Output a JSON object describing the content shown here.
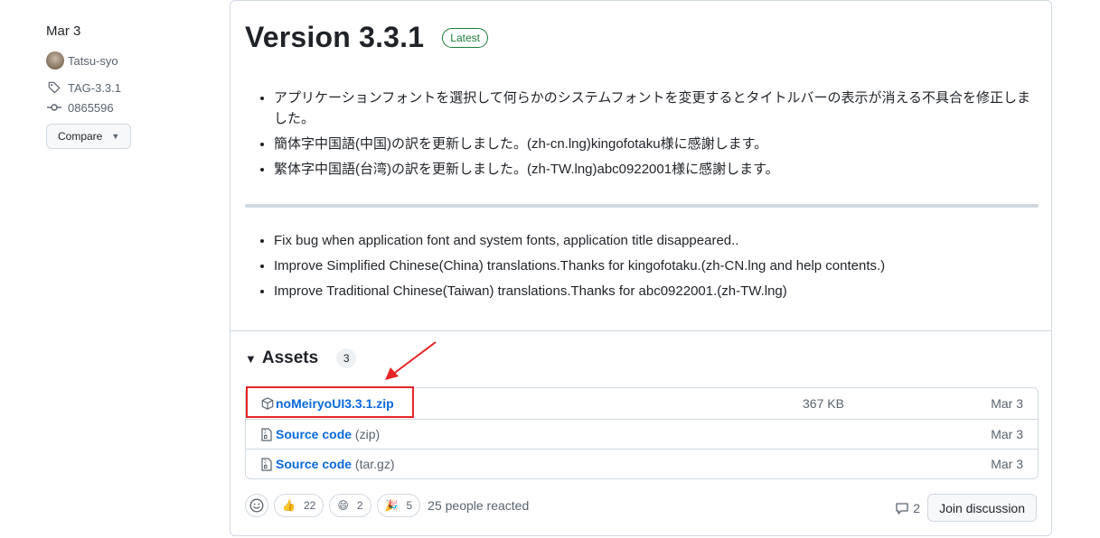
{
  "sidebar": {
    "date": "Mar 3",
    "author": "Tatsu-syo",
    "tag": "TAG-3.3.1",
    "commit": "0865596",
    "compare_label": "Compare"
  },
  "release": {
    "title": "Version 3.3.1",
    "badge": "Latest",
    "notes_jp": [
      "アプリケーションフォントを選択して何らかのシステムフォントを変更するとタイトルバーの表示が消える不具合を修正しました。",
      "簡体字中国語(中国)の訳を更新しました。(zh-cn.lng)kingofotaku様に感謝します。",
      "繁体字中国語(台湾)の訳を更新しました。(zh-TW.lng)abc0922001様に感謝します。"
    ],
    "notes_en": [
      "Fix bug when application font and system fonts, application title disappeared..",
      "Improve Simplified Chinese(China) translations.Thanks for kingofotaku.(zh-CN.lng and help contents.)",
      "Improve Traditional Chinese(Taiwan) translations.Thanks for abc0922001.(zh-TW.lng)"
    ]
  },
  "assets": {
    "title": "Assets",
    "count": "3",
    "items": [
      {
        "name": "noMeiryoUI3.3.1.zip",
        "ext": "",
        "size": "367 KB",
        "date": "Mar 3",
        "icon": "package-icon"
      },
      {
        "name": "Source code",
        "ext": "(zip)",
        "size": "",
        "date": "Mar 3",
        "icon": "file-zip-icon"
      },
      {
        "name": "Source code",
        "ext": "(tar.gz)",
        "size": "",
        "date": "Mar 3",
        "icon": "file-zip-icon"
      }
    ]
  },
  "reactions": {
    "thumbs_up": "22",
    "laugh": "2",
    "hooray": "5",
    "summary": "25 people reacted"
  },
  "discussion": {
    "comment_count": "2",
    "join_label": "Join discussion"
  },
  "colors": {
    "link": "#0969da",
    "latest_badge": "#1a7f37",
    "highlight": "#e52525"
  }
}
